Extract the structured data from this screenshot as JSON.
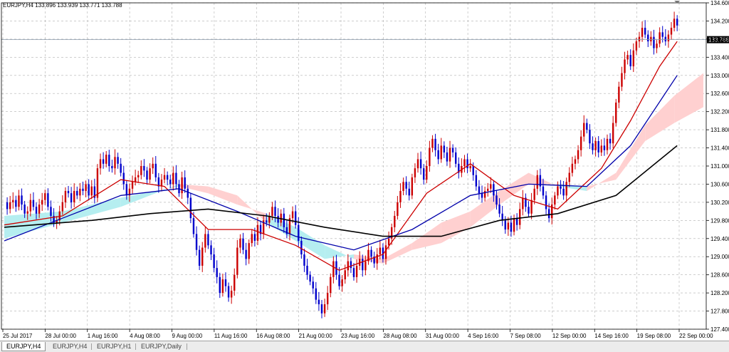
{
  "header": {
    "ohlc_text": "EURJPY,H4  133.896 133.939 133.771 133.788"
  },
  "tabs": [
    {
      "label": "EURJPY,H4",
      "active": true
    },
    {
      "label": "EURJPY,H4",
      "active": false
    },
    {
      "label": "EURJPY,H1",
      "active": false
    },
    {
      "label": "EURJPY,Daily",
      "active": false
    }
  ],
  "colors": {
    "bull": "#cc0000",
    "bear": "#0000cc",
    "sma_fast": "#cc0000",
    "sma_mid": "#0000aa",
    "sma_slow": "#000000",
    "kumo_bull": "#ffd0d0",
    "kumo_bear": "#b5eef0",
    "price_line": "#8899aa",
    "grid": "#b0b0b0"
  },
  "chart_data": {
    "type": "line",
    "symbol": "EURJPY,H4",
    "ylim": [
      127.4,
      134.6
    ],
    "y_ticks": [
      "134.600",
      "134.200",
      "133.800",
      "133.400",
      "133.000",
      "132.600",
      "132.200",
      "131.800",
      "131.400",
      "131.000",
      "130.600",
      "130.200",
      "129.800",
      "129.400",
      "129.000",
      "128.600",
      "128.200",
      "127.800",
      "127.400"
    ],
    "x_ticks": [
      "25 Jul 2017",
      "28 Jul 00:00",
      "1 Aug 16:00",
      "4 Aug 08:00",
      "9 Aug 00:00",
      "11 Aug 16:00",
      "16 Aug 08:00",
      "21 Aug 00:00",
      "23 Aug 16:00",
      "28 Aug 08:00",
      "31 Aug 00:00",
      "4 Sep 16:00",
      "7 Sep 08:00",
      "12 Sep 00:00",
      "14 Sep 16:00",
      "19 Sep 08:00",
      "22 Sep 00:00"
    ],
    "current_price": 133.788,
    "current_price_label": "133.788",
    "price_series": {
      "name": "",
      "x": [
        0,
        1,
        2,
        3,
        4,
        5,
        6,
        7,
        8,
        9,
        10,
        11,
        12,
        13,
        14,
        15,
        16,
        17,
        18,
        19,
        20,
        21,
        22,
        23,
        24,
        25,
        26,
        27,
        28,
        29,
        30,
        31,
        32,
        33,
        34,
        35,
        36,
        37,
        38,
        39,
        40,
        41,
        42,
        43,
        44,
        45,
        46,
        47,
        48,
        49,
        50,
        51,
        52,
        53,
        54,
        55,
        56,
        57,
        58,
        59,
        60,
        61,
        62,
        63,
        64,
        65,
        66,
        67,
        68,
        69,
        70,
        71,
        72,
        73,
        74,
        75,
        76,
        77,
        78,
        79,
        80,
        81,
        82,
        83,
        84,
        85,
        86,
        87,
        88,
        89,
        90,
        91,
        92,
        93,
        94,
        95,
        96,
        97,
        98,
        99,
        100,
        101,
        102,
        103,
        104,
        105,
        106,
        107,
        108,
        109,
        110,
        111,
        112,
        113,
        114,
        115,
        116,
        117,
        118,
        119,
        120,
        121,
        122,
        123,
        124,
        125,
        126,
        127,
        128,
        129,
        130,
        131,
        132,
        133,
        134,
        135,
        136,
        137,
        138,
        139,
        140,
        141,
        142,
        143,
        144,
        145,
        146,
        147,
        148,
        149,
        150,
        151,
        152,
        153,
        154,
        155,
        156,
        157,
        158,
        159,
        160,
        161,
        162,
        163,
        164,
        165,
        166,
        167,
        168,
        169,
        170,
        171,
        172,
        173,
        174,
        175,
        176,
        177,
        178,
        179,
        180,
        181,
        182,
        183,
        184,
        185,
        186,
        187,
        188,
        189,
        190,
        191,
        192,
        193,
        194,
        195,
        196,
        197,
        198,
        199,
        200,
        201,
        202,
        203,
        204,
        205,
        206,
        207,
        208,
        209,
        210,
        211,
        212,
        213,
        214,
        215,
        216,
        217,
        218,
        219,
        220,
        221,
        222,
        223,
        224,
        225,
        226,
        227,
        228,
        229,
        230,
        231
      ],
      "y": [
        130.2,
        130.05,
        130.2,
        130.25,
        130.1,
        130.35,
        130.15,
        129.95,
        130.0,
        130.25,
        130.1,
        129.95,
        130.15,
        130.25,
        130.4,
        130.1,
        129.9,
        129.75,
        129.8,
        130.0,
        130.2,
        130.45,
        130.4,
        130.2,
        130.45,
        130.35,
        130.5,
        130.45,
        130.6,
        130.35,
        130.55,
        130.3,
        130.95,
        131.15,
        131.05,
        131.25,
        131.0,
        130.95,
        131.2,
        131.05,
        130.85,
        130.6,
        130.35,
        130.5,
        130.65,
        130.75,
        130.8,
        131.0,
        130.9,
        130.7,
        130.95,
        131.05,
        130.75,
        130.55,
        130.7,
        130.8,
        130.7,
        130.6,
        130.85,
        130.6,
        130.4,
        130.75,
        130.5,
        130.3,
        129.85,
        129.5,
        129.15,
        128.8,
        129.2,
        129.5,
        129.25,
        129.05,
        128.75,
        128.55,
        128.2,
        128.5,
        128.35,
        128.1,
        128.25,
        128.6,
        129.2,
        129.4,
        129.15,
        128.95,
        129.3,
        129.5,
        129.35,
        129.7,
        129.5,
        129.8,
        129.75,
        129.9,
        130.1,
        129.9,
        129.75,
        129.95,
        129.65,
        129.5,
        129.85,
        130.0,
        129.7,
        129.35,
        129.05,
        128.8,
        128.6,
        128.45,
        128.3,
        128.05,
        127.95,
        127.75,
        127.95,
        128.2,
        128.55,
        128.9,
        128.6,
        128.35,
        128.5,
        128.7,
        128.9,
        128.75,
        128.55,
        128.8,
        128.95,
        128.7,
        128.9,
        129.15,
        129.0,
        128.85,
        129.05,
        129.2,
        128.95,
        129.25,
        129.4,
        129.65,
        129.9,
        130.2,
        130.45,
        130.65,
        130.5,
        130.35,
        130.75,
        130.95,
        131.15,
        130.95,
        130.7,
        131.0,
        131.4,
        131.6,
        131.35,
        131.15,
        131.45,
        131.3,
        131.1,
        131.4,
        131.3,
        131.05,
        130.85,
        131.0,
        131.15,
        130.95,
        131.0,
        130.8,
        130.55,
        130.4,
        130.3,
        130.45,
        130.5,
        130.6,
        130.35,
        130.15,
        129.95,
        129.8,
        129.6,
        129.75,
        129.55,
        129.85,
        129.7,
        130.05,
        130.3,
        130.1,
        129.95,
        130.25,
        130.5,
        130.8,
        130.55,
        130.35,
        130.05,
        129.85,
        130.15,
        130.35,
        130.55,
        130.5,
        130.35,
        130.65,
        130.85,
        131.05,
        131.15,
        131.35,
        131.65,
        131.95,
        131.8,
        131.5,
        131.35,
        131.55,
        131.3,
        131.45,
        131.35,
        131.6,
        131.5,
        131.95,
        132.4,
        132.75,
        133.05,
        133.35,
        133.45,
        133.2,
        133.55,
        133.75,
        133.85,
        134.05,
        133.9,
        133.75,
        133.85,
        133.6,
        133.7,
        133.95,
        133.85,
        133.75,
        133.9,
        134.05,
        134.25,
        134.1,
        134.2,
        133.95,
        133.8,
        133.79
      ]
    },
    "series": [
      {
        "name": "",
        "role": "sma_fast",
        "x": [
          0,
          20,
          40,
          55,
          70,
          85,
          100,
          115,
          130,
          145,
          160,
          175,
          190,
          205,
          215,
          225,
          231
        ],
        "y": [
          129.7,
          129.9,
          130.7,
          130.55,
          129.6,
          129.6,
          129.25,
          128.7,
          129.05,
          130.4,
          131.05,
          130.35,
          130.05,
          130.95,
          132.0,
          133.2,
          133.75
        ]
      },
      {
        "name": "",
        "role": "sma_mid",
        "x": [
          0,
          20,
          40,
          60,
          80,
          100,
          120,
          140,
          160,
          180,
          200,
          215,
          231
        ],
        "y": [
          129.35,
          129.85,
          130.35,
          130.5,
          130.0,
          129.45,
          129.15,
          129.6,
          130.35,
          130.6,
          130.55,
          131.45,
          133.0
        ]
      },
      {
        "name": "",
        "role": "sma_slow",
        "x": [
          0,
          30,
          50,
          70,
          90,
          110,
          130,
          150,
          170,
          190,
          210,
          231
        ],
        "y": [
          129.65,
          129.8,
          129.95,
          130.05,
          129.9,
          129.65,
          129.45,
          129.45,
          129.8,
          129.95,
          130.35,
          131.45
        ]
      }
    ],
    "kumo": {
      "x": [
        0,
        20,
        40,
        60,
        70,
        80,
        90,
        100,
        110,
        120,
        130,
        140,
        150,
        160,
        170,
        180,
        190,
        200,
        210,
        220,
        230,
        240
      ],
      "span_a": [
        129.4,
        129.75,
        130.1,
        130.6,
        130.55,
        130.35,
        129.75,
        129.35,
        128.95,
        129.05,
        128.95,
        129.3,
        129.75,
        130.0,
        130.45,
        130.85,
        130.55,
        130.45,
        130.85,
        131.9,
        132.55,
        133.05
      ],
      "span_b": [
        129.9,
        130.0,
        130.3,
        130.55,
        130.4,
        130.15,
        129.95,
        129.65,
        129.25,
        128.95,
        128.85,
        129.15,
        129.3,
        129.65,
        130.15,
        130.6,
        130.6,
        130.55,
        130.7,
        131.55,
        131.95,
        132.3
      ]
    },
    "grid": true
  }
}
